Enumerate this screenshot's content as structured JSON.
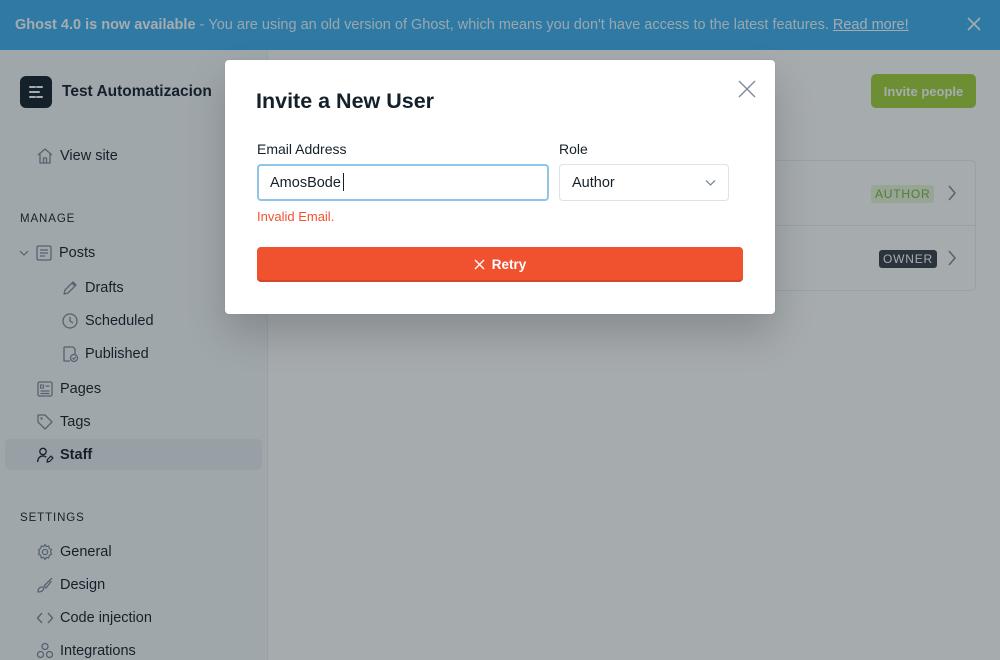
{
  "banner": {
    "title": "Ghost 4.0 is now available",
    "separator": " - ",
    "message": "You are using an old version of Ghost, which means you don't have access to the latest features.",
    "link": "Read more!"
  },
  "sidebar": {
    "site_name": "Test Automatizacion",
    "view_site": "View site",
    "manage_title": "MANAGE",
    "posts": "Posts",
    "drafts": "Drafts",
    "scheduled": "Scheduled",
    "published": "Published",
    "pages": "Pages",
    "tags": "Tags",
    "staff": "Staff",
    "settings_title": "SETTINGS",
    "general": "General",
    "design": "Design",
    "code_injection": "Code injection",
    "integrations": "Integrations"
  },
  "main": {
    "invite_button": "Invite people",
    "staff": [
      {
        "role_badge": "AUTHOR"
      },
      {
        "role_badge": "OWNER"
      }
    ]
  },
  "modal": {
    "title": "Invite a New User",
    "email_label": "Email Address",
    "email_value": "AmosBode",
    "role_label": "Role",
    "role_value": "Author",
    "error": "Invalid Email.",
    "retry_button": "Retry"
  },
  "colors": {
    "banner": "#3eb0ef",
    "error": "#f05230",
    "invite": "#a4d037"
  }
}
